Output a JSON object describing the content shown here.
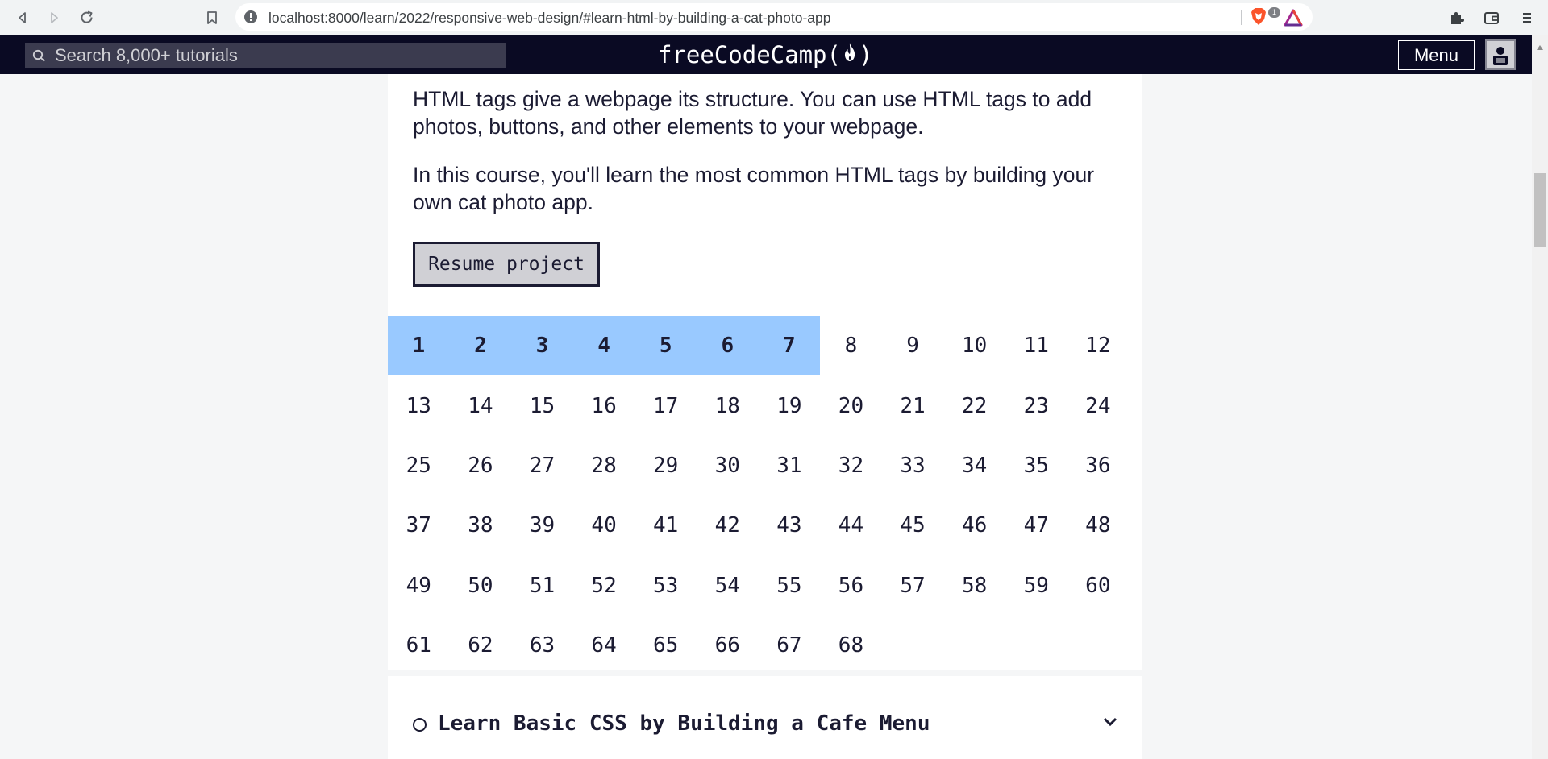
{
  "browser": {
    "url": "localhost:8000/learn/2022/responsive-web-design/#learn-html-by-building-a-cat-photo-app",
    "brave_badge": "1",
    "icons": [
      "back-icon",
      "forward-icon",
      "reload-icon",
      "bookmark-icon",
      "site-info-icon",
      "brave-shields-icon",
      "brave-rewards-icon",
      "extensions-icon",
      "wallet-icon",
      "browser-menu-icon"
    ]
  },
  "nav": {
    "search_placeholder": "Search 8,000+ tutorials",
    "logo_left": "freeCodeCamp(",
    "logo_right": ")",
    "menu_label": "Menu",
    "background_color": "#0a0a23"
  },
  "intro": {
    "paragraph_1": "HTML tags give a webpage its structure. You can use HTML tags to add photos, buttons, and other elements to your webpage.",
    "paragraph_2": "In this course, you'll learn the most common HTML tags by building your own cat photo app.",
    "resume_label": "Resume project"
  },
  "steps": {
    "total": 68,
    "completed": 7,
    "completed_color": "#99c9ff",
    "labels": [
      "1",
      "2",
      "3",
      "4",
      "5",
      "6",
      "7",
      "8",
      "9",
      "10",
      "11",
      "12",
      "13",
      "14",
      "15",
      "16",
      "17",
      "18",
      "19",
      "20",
      "21",
      "22",
      "23",
      "24",
      "25",
      "26",
      "27",
      "28",
      "29",
      "30",
      "31",
      "32",
      "33",
      "34",
      "35",
      "36",
      "37",
      "38",
      "39",
      "40",
      "41",
      "42",
      "43",
      "44",
      "45",
      "46",
      "47",
      "48",
      "49",
      "50",
      "51",
      "52",
      "53",
      "54",
      "55",
      "56",
      "57",
      "58",
      "59",
      "60",
      "61",
      "62",
      "63",
      "64",
      "65",
      "66",
      "67",
      "68"
    ]
  },
  "next_section": {
    "title": "Learn Basic CSS by Building a Cafe Menu"
  }
}
